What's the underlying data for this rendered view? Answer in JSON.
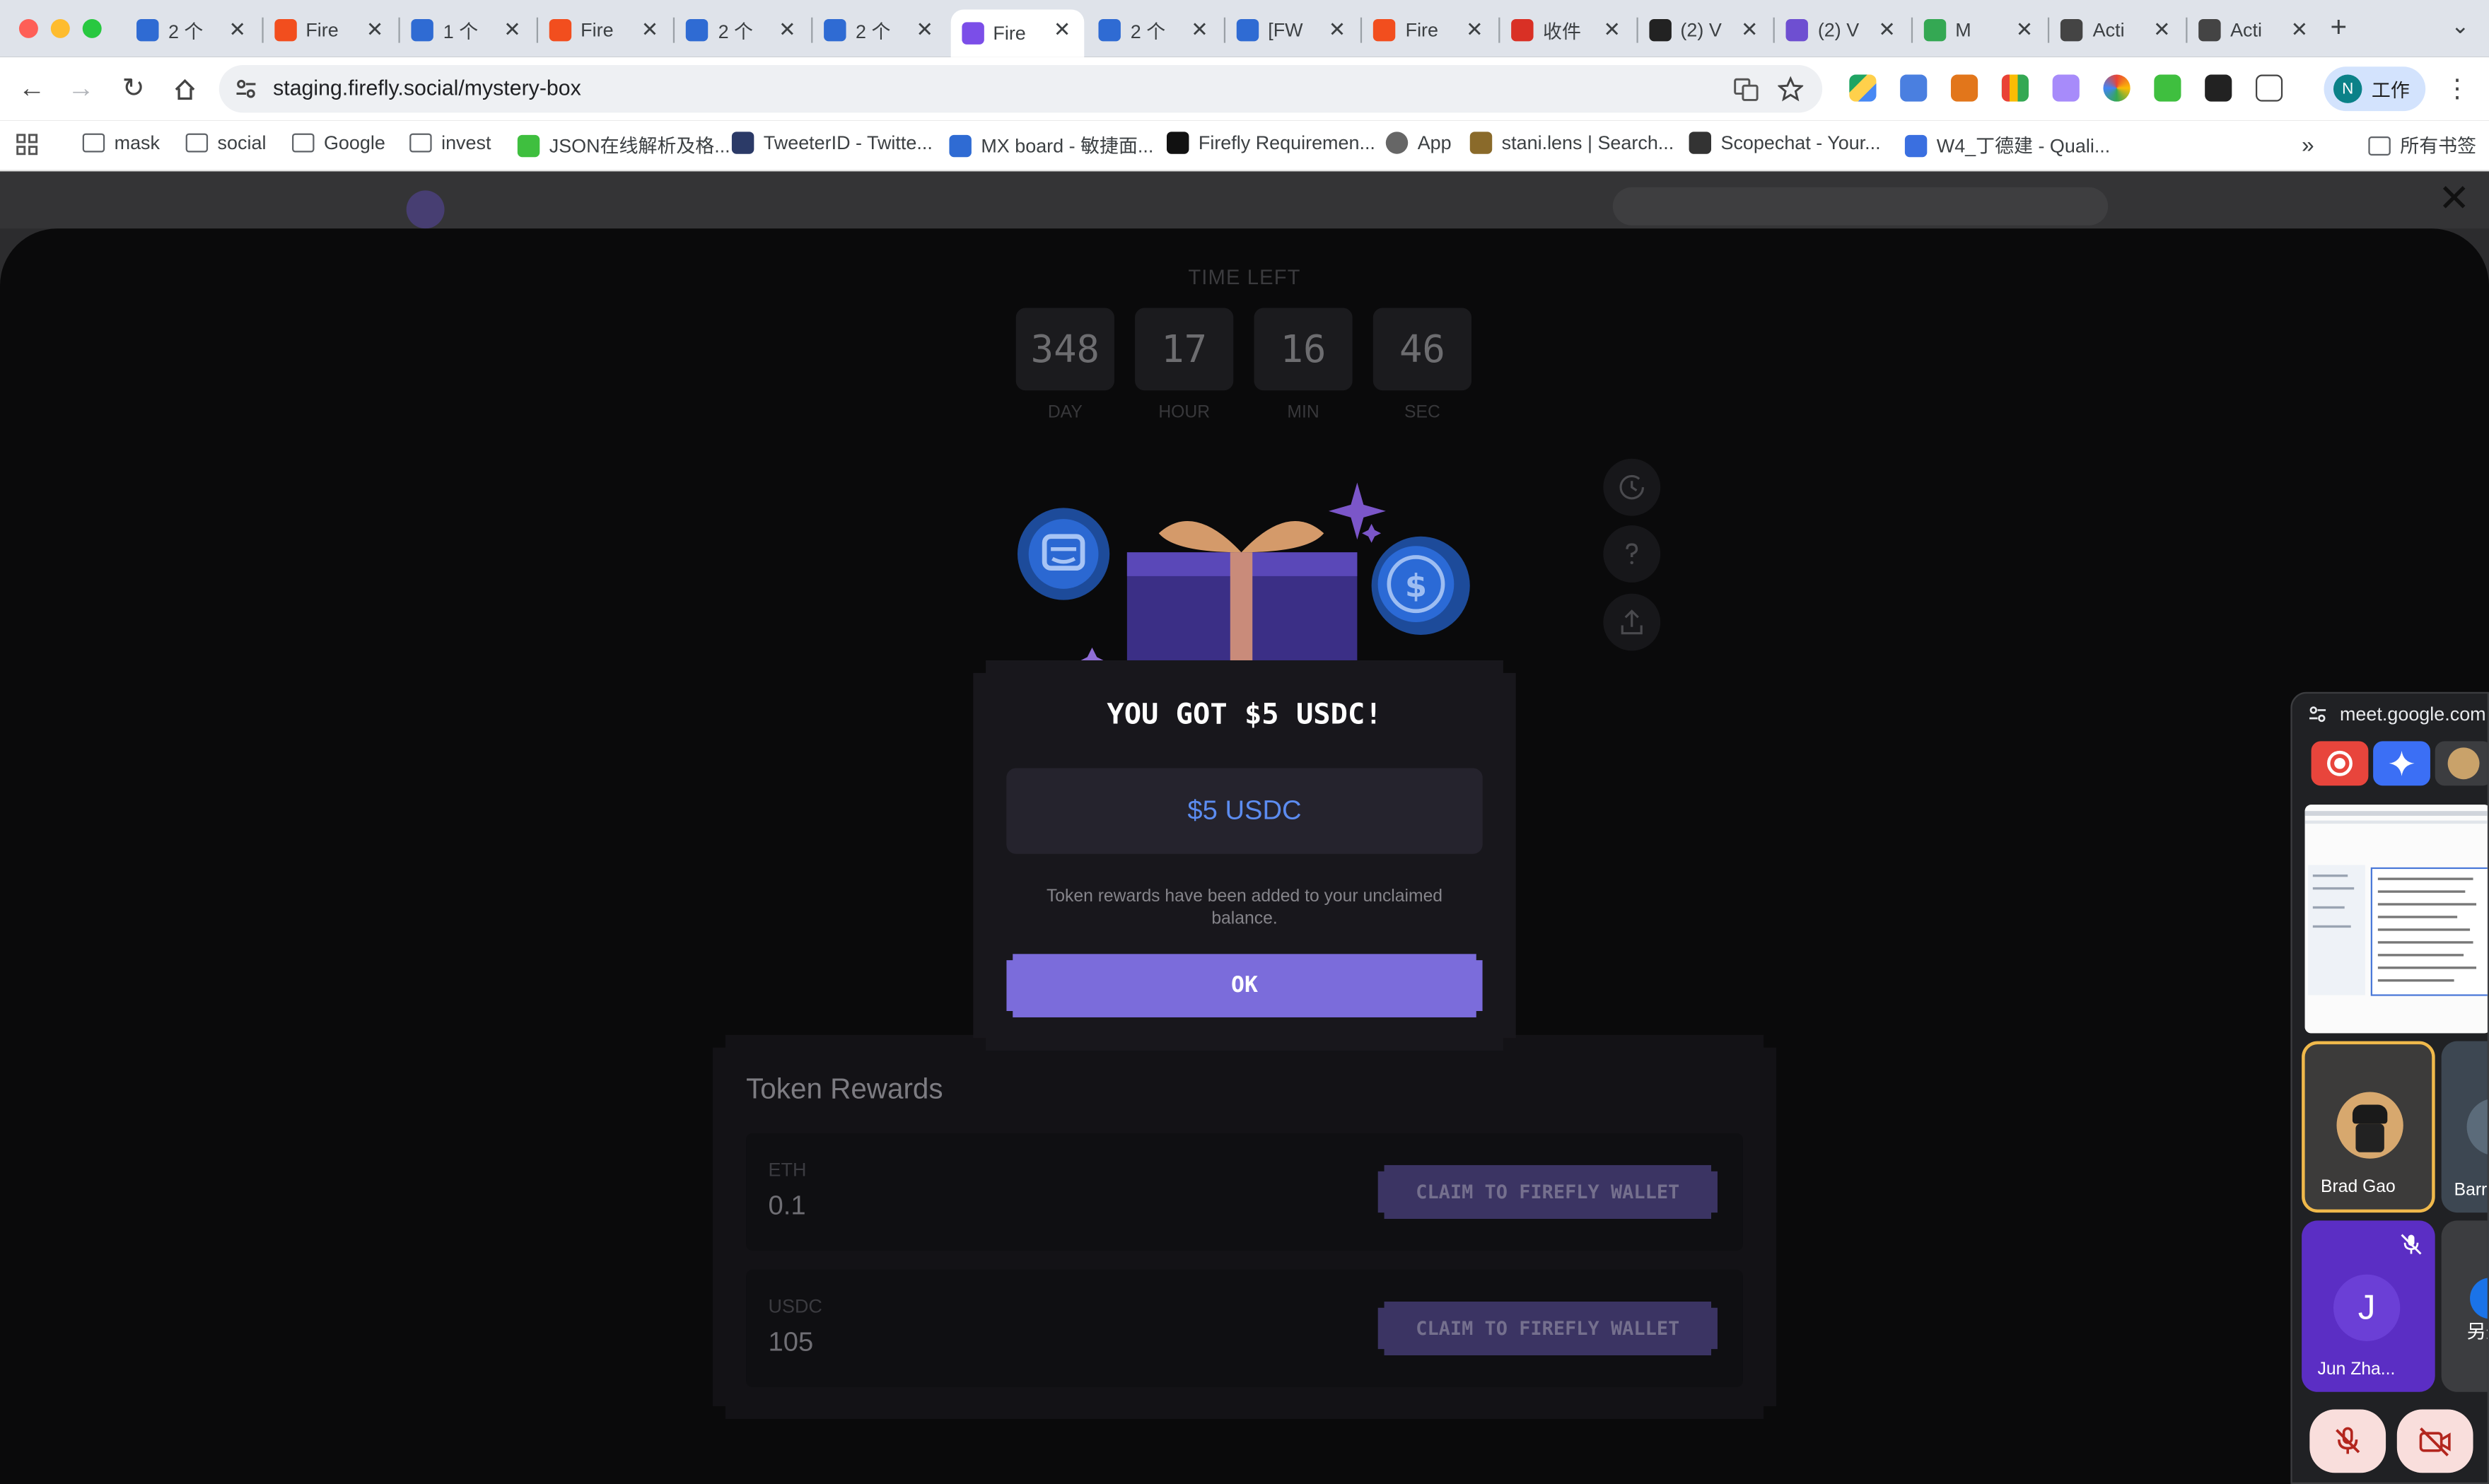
{
  "browser": {
    "tabs": [
      {
        "label": "2 个"
      },
      {
        "label": "Fire"
      },
      {
        "label": "1 个"
      },
      {
        "label": "Fire"
      },
      {
        "label": "2 个"
      },
      {
        "label": "2 个"
      },
      {
        "label": "Fire",
        "active": true
      },
      {
        "label": "2 个"
      },
      {
        "label": "[FW"
      },
      {
        "label": "Fire"
      },
      {
        "label": "收件"
      },
      {
        "label": "(2) V"
      },
      {
        "label": "(2) V"
      },
      {
        "label": "M"
      },
      {
        "label": "Acti"
      },
      {
        "label": "Acti"
      }
    ],
    "url": "staging.firefly.social/mystery-box",
    "profile_label": "工作",
    "profile_initial": "N",
    "bookmarks": [
      {
        "label": "mask",
        "icon": "folder-icon"
      },
      {
        "label": "social",
        "icon": "folder-icon"
      },
      {
        "label": "Google",
        "icon": "folder-icon"
      },
      {
        "label": "invest",
        "icon": "folder-icon"
      },
      {
        "label": "JSON在线解析及格...",
        "icon": "json-icon"
      },
      {
        "label": "TweeterID - Twitte...",
        "icon": "id-icon"
      },
      {
        "label": "MX board - 敏捷面...",
        "icon": "jira-icon"
      },
      {
        "label": "Firefly Requiremen...",
        "icon": "notion-icon"
      },
      {
        "label": "App",
        "icon": "globe-icon"
      },
      {
        "label": "stani.lens | Search...",
        "icon": "lens-icon"
      },
      {
        "label": "Scopechat - Your...",
        "icon": "scope-icon"
      },
      {
        "label": "W4_丁德建 - Quali...",
        "icon": "x-icon"
      }
    ],
    "all_bookmarks": "所有书签"
  },
  "mystery_box": {
    "time_left_title": "TIME LEFT",
    "countdown": [
      {
        "value": "348",
        "unit": "DAY"
      },
      {
        "value": "17",
        "unit": "HOUR"
      },
      {
        "value": "16",
        "unit": "MIN"
      },
      {
        "value": "46",
        "unit": "SEC"
      }
    ],
    "popup": {
      "title": "YOU GOT $5 USDC!",
      "amount": "$5 USDC",
      "description": "Token rewards have been added to your unclaimed balance.",
      "ok_label": "OK"
    },
    "rewards": {
      "title": "Token Rewards",
      "items": [
        {
          "token": "ETH",
          "value": "0.1",
          "claim_label": "CLAIM TO FIREFLY WALLET"
        },
        {
          "token": "USDC",
          "value": "105",
          "claim_label": "CLAIM TO FIREFLY WALLET"
        }
      ]
    }
  },
  "meet": {
    "domain": "meet.google.com",
    "participants": [
      {
        "name": "Brad Gao"
      },
      {
        "name": "Barr"
      },
      {
        "name": "Jun Zha...",
        "initial": "J"
      },
      {
        "name": "另外"
      }
    ]
  },
  "colors": {
    "accent": "#7b6cdb",
    "amount_text": "#5c8cf0",
    "claim_button": "#3b3463"
  }
}
